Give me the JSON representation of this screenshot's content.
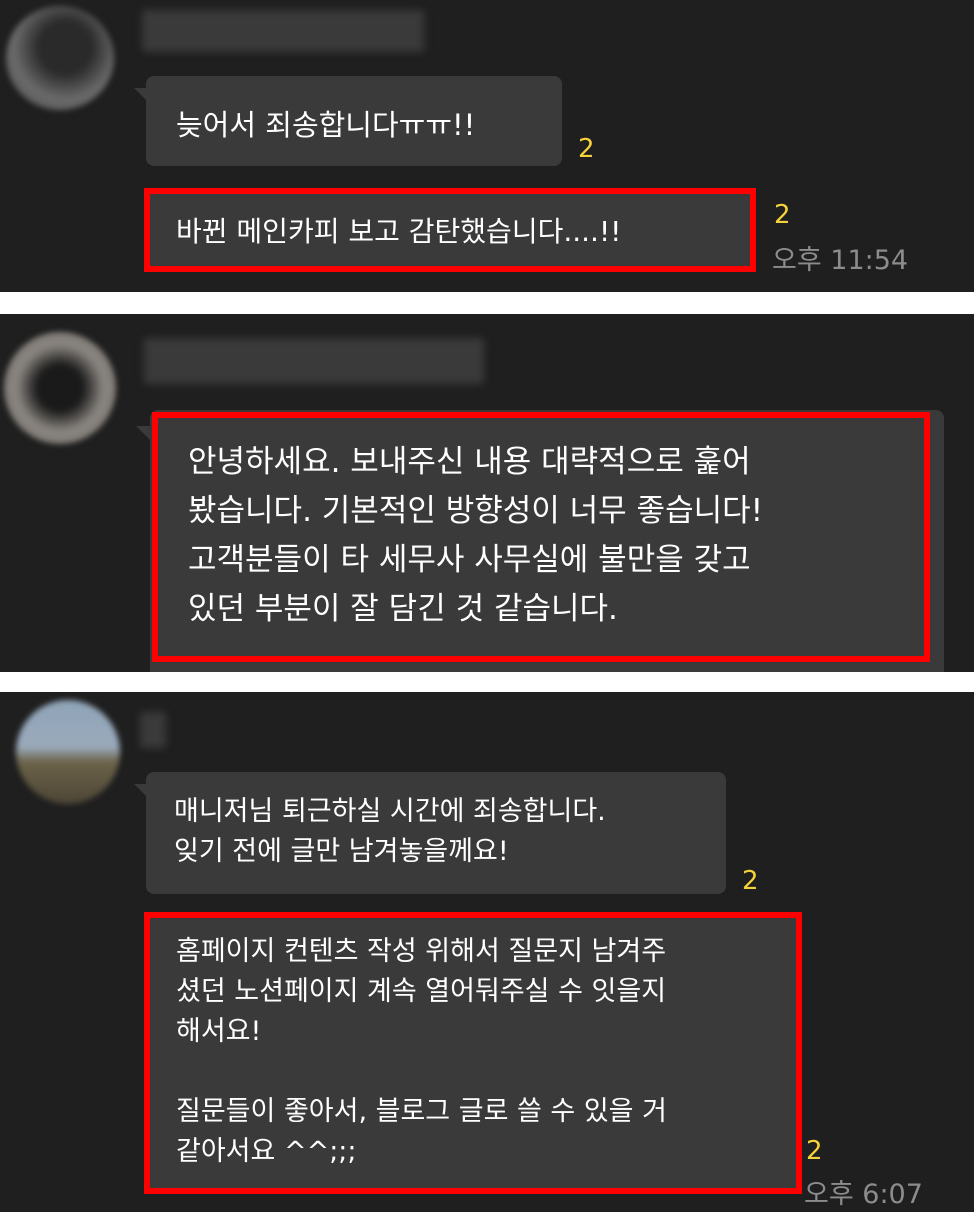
{
  "accent": {
    "highlight": "#ff0000",
    "unread": "#f4d23a",
    "bubble": "#3a3a3a",
    "background": "#1f1f1f"
  },
  "chat1": {
    "messages": [
      {
        "text": "늦어서 죄송합니다ㅠㅠ!!",
        "unread": "2"
      },
      {
        "text": "바뀐 메인카피 보고 감탄했습니다....!!",
        "unread": "2",
        "time": "오후 11:54"
      }
    ]
  },
  "chat2": {
    "messages": [
      {
        "text": "안녕하세요. 보내주신 내용 대략적으로 훑어\n봤습니다. 기본적인 방향성이 너무 좋습니다!\n고객분들이 타 세무사 사무실에 불만을 갖고\n있던 부분이 잘 담긴 것 같습니다."
      }
    ]
  },
  "chat3": {
    "messages": [
      {
        "text": "매니저님 퇴근하실 시간에 죄송합니다.\n잊기 전에 글만 남겨놓을께요!",
        "unread": "2"
      },
      {
        "text": "홈페이지 컨텐츠 작성 위해서 질문지 남겨주\n셨던 노션페이지 계속 열어둬주실 수 잇을지\n해서요!\n\n질문들이 좋아서, 블로그 글로 쓸 수 있을 거\n같아서요 ^^;;;",
        "unread": "2",
        "time": "오후 6:07"
      }
    ]
  }
}
